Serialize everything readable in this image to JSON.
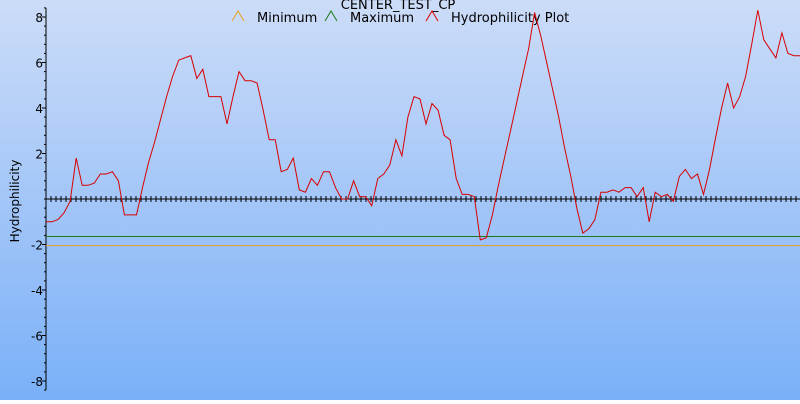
{
  "chart_data": {
    "type": "line",
    "title": "CENTER_TEST_CP",
    "ylabel": "Hydrophilicity",
    "xlabel": "",
    "ylim": [
      -8.4,
      8.4
    ],
    "xlim": [
      0,
      153
    ],
    "yticks": [
      -8,
      -6,
      -4,
      -2,
      2,
      4,
      6,
      8
    ],
    "ytick_labels": [
      "-8",
      "-6",
      "-4",
      "-2",
      "2",
      "4",
      "6",
      "8"
    ],
    "background": {
      "top": "#ccdcf8",
      "bottom": "#7ab0f8"
    },
    "legend": {
      "placement": "top",
      "entries": [
        {
          "name": "Minimum",
          "color": "#e8a020"
        },
        {
          "name": "Maximum",
          "color": "#1a7a1a"
        },
        {
          "name": "Hydrophilicity Plot",
          "color": "#d80000"
        }
      ]
    },
    "series": [
      {
        "name": "Minimum",
        "color": "#e8a020",
        "values": [
          -2.05,
          -2.05
        ]
      },
      {
        "name": "Maximum",
        "color": "#1a7a1a",
        "values": [
          -1.65,
          -1.65
        ]
      },
      {
        "name": "Hydrophilicity Plot",
        "color": "#d80000",
        "values": [
          -1.0,
          -1.0,
          -0.9,
          -0.6,
          -0.1,
          1.8,
          0.6,
          0.6,
          0.7,
          1.1,
          1.1,
          1.2,
          0.8,
          -0.7,
          -0.7,
          -0.7,
          0.5,
          1.6,
          2.5,
          3.5,
          4.5,
          5.4,
          6.1,
          6.2,
          6.3,
          5.3,
          5.7,
          4.5,
          4.5,
          4.5,
          3.3,
          4.5,
          5.6,
          5.2,
          5.2,
          5.1,
          3.9,
          2.6,
          2.6,
          1.2,
          1.3,
          1.8,
          0.4,
          0.3,
          0.9,
          0.6,
          1.2,
          1.2,
          0.5,
          0.0,
          0.0,
          0.8,
          0.1,
          0.1,
          -0.3,
          0.9,
          1.1,
          1.5,
          2.6,
          1.9,
          3.6,
          4.5,
          4.4,
          3.3,
          4.2,
          3.9,
          2.8,
          2.6,
          0.9,
          0.2,
          0.2,
          0.1,
          -1.8,
          -1.7,
          -0.7,
          0.6,
          1.8,
          3.0,
          4.2,
          5.4,
          6.6,
          8.2,
          7.2,
          6.0,
          4.8,
          3.6,
          2.2,
          1.0,
          -0.4,
          -1.5,
          -1.3,
          -0.9,
          0.3,
          0.3,
          0.4,
          0.3,
          0.5,
          0.5,
          0.1,
          0.5,
          -1.0,
          0.3,
          0.1,
          0.2,
          -0.1,
          1.0,
          1.3,
          0.9,
          1.1,
          0.2,
          1.3,
          2.7,
          4.0,
          5.1,
          4.0,
          4.5,
          5.4,
          6.8,
          8.3,
          7.0,
          6.6,
          6.2,
          7.3,
          6.4,
          6.3,
          6.3
        ]
      }
    ]
  }
}
